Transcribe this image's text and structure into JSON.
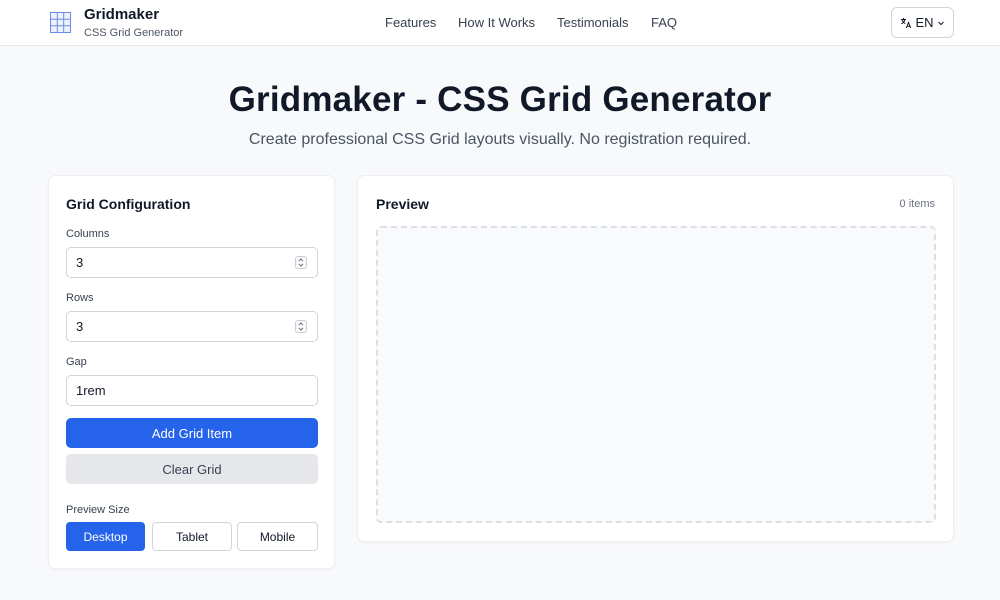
{
  "header": {
    "brand_title": "Gridmaker",
    "brand_subtitle": "CSS Grid Generator",
    "logo_icon": "grid-icon",
    "nav": [
      {
        "label": "Features"
      },
      {
        "label": "How It Works"
      },
      {
        "label": "Testimonials"
      },
      {
        "label": "FAQ"
      }
    ],
    "language": {
      "label": "EN",
      "icon": "translate-icon",
      "caret_icon": "chevron-down-icon"
    }
  },
  "hero": {
    "title": "Gridmaker - CSS Grid Generator",
    "subtitle": "Create professional CSS Grid layouts visually. No registration required."
  },
  "config": {
    "title": "Grid Configuration",
    "columns": {
      "label": "Columns",
      "value": "3"
    },
    "rows": {
      "label": "Rows",
      "value": "3"
    },
    "gap": {
      "label": "Gap",
      "value": "1rem"
    },
    "add_button": "Add Grid Item",
    "clear_button": "Clear Grid",
    "preview_size": {
      "label": "Preview Size",
      "options": [
        "Desktop",
        "Tablet",
        "Mobile"
      ],
      "selected": "Desktop"
    }
  },
  "preview": {
    "title": "Preview",
    "item_count": "0 items"
  },
  "colors": {
    "accent": "#2563eb",
    "background": "#f8f9fb",
    "card": "#ffffff",
    "secondary_button": "#e5e7eb"
  }
}
